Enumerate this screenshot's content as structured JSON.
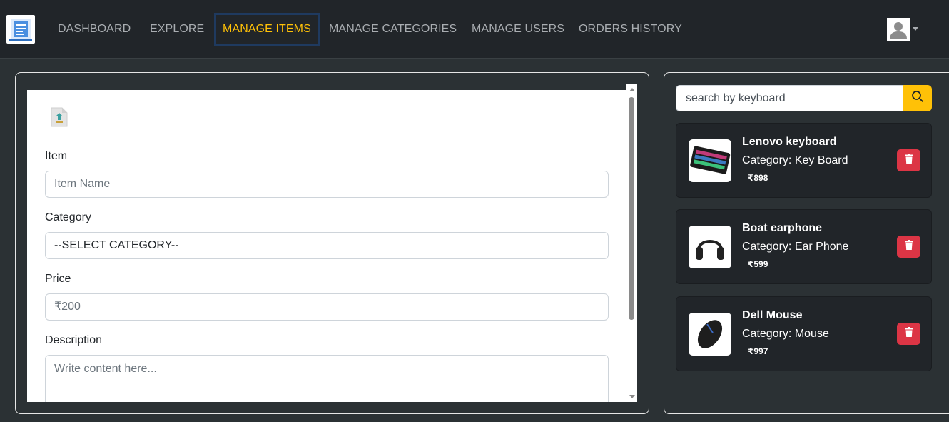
{
  "nav": {
    "links": [
      {
        "label": "DASHBOARD",
        "active": false
      },
      {
        "label": "EXPLORE",
        "active": false
      },
      {
        "label": "MANAGE ITEMS",
        "active": true
      },
      {
        "label": "MANAGE CATEGORIES",
        "active": false
      },
      {
        "label": "MANAGE USERS",
        "active": false
      },
      {
        "label": "ORDERS HISTORY",
        "active": false
      }
    ],
    "logo_icon": "app-logo-icon",
    "user_icon": "user-avatar-icon",
    "active_color": "#ffc107"
  },
  "form": {
    "upload_icon": "upload-icon",
    "item_label": "Item",
    "item_placeholder": "Item Name",
    "category_label": "Category",
    "category_selected": "--SELECT CATEGORY--",
    "price_label": "Price",
    "price_placeholder": "₹200",
    "description_label": "Description",
    "description_placeholder": "Write content here..."
  },
  "search": {
    "placeholder": "search by keyboard",
    "icon": "search-icon"
  },
  "items": [
    {
      "name": "Lenovo keyboard",
      "category": "Category: Key Board",
      "price": "₹898",
      "thumb": "keyboard-image"
    },
    {
      "name": "Boat earphone",
      "category": "Category: Ear Phone",
      "price": "₹599",
      "thumb": "headphone-image"
    },
    {
      "name": "Dell Mouse",
      "category": "Category: Mouse",
      "price": "₹997",
      "thumb": "mouse-image"
    }
  ],
  "colors": {
    "accent": "#ffc107",
    "danger": "#dc3545",
    "card_bg": "#212529",
    "page_bg": "#2b3134"
  }
}
